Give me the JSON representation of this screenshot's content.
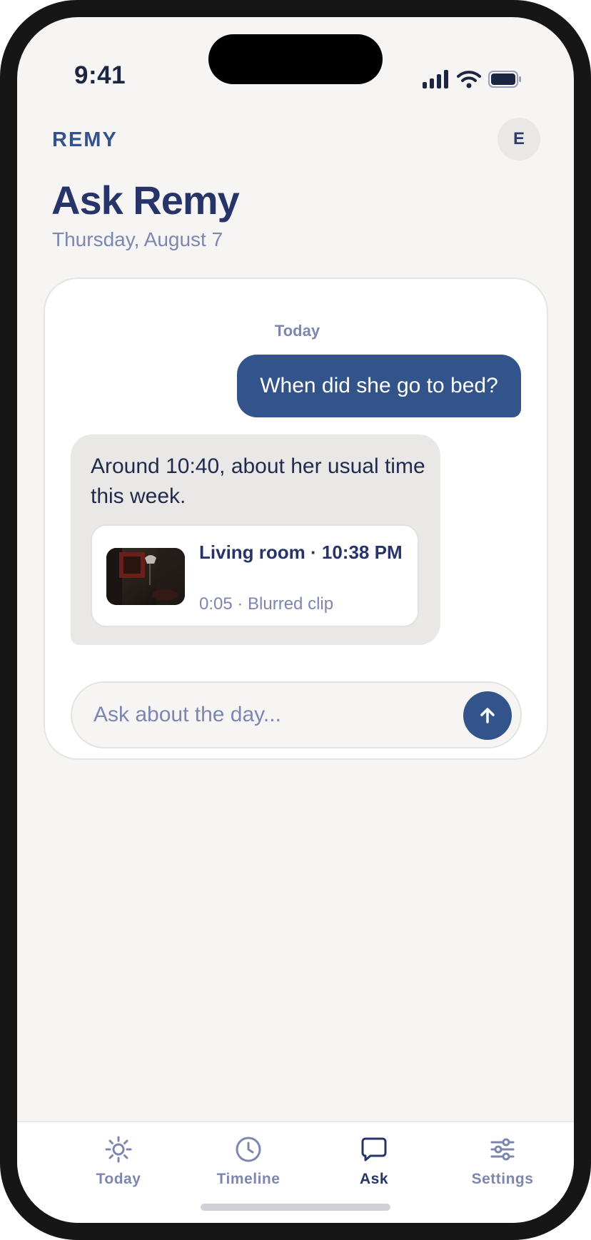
{
  "status_bar": {
    "time": "9:41"
  },
  "header": {
    "brand": "REMY",
    "avatar_initial": "E",
    "title": "Ask Remy",
    "date": "Thursday, August 7"
  },
  "chat": {
    "day_label": "Today",
    "messages": [
      {
        "role": "user",
        "text": "When did she go to bed?"
      },
      {
        "role": "assistant",
        "text": "Around 10:40, about her usual time this week.",
        "attachment": {
          "title": "Living room · 10:38 PM",
          "meta": "0:05 · Blurred clip"
        }
      }
    ],
    "input": {
      "placeholder": "Ask about the day...",
      "value": ""
    }
  },
  "tabs": [
    {
      "label": "Today",
      "icon": "sun-icon",
      "active": false
    },
    {
      "label": "Timeline",
      "icon": "clock-icon",
      "active": false
    },
    {
      "label": "Ask",
      "icon": "chat-bubble-icon",
      "active": true
    },
    {
      "label": "Settings",
      "icon": "sliders-icon",
      "active": false
    }
  ],
  "colors": {
    "accent": "#33548a",
    "title": "#26346a",
    "muted": "#7c86b1",
    "background": "#f6f5f4"
  }
}
